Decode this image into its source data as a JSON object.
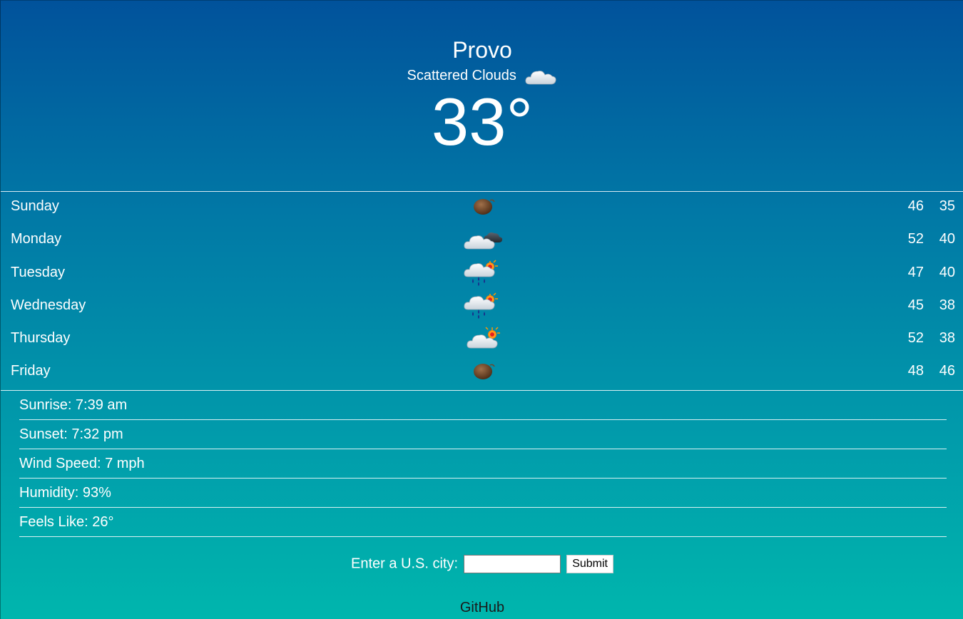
{
  "current": {
    "city": "Provo",
    "condition": "Scattered Clouds",
    "condition_icon": "scattered-clouds-icon",
    "temperature": "33°"
  },
  "forecast": [
    {
      "day": "Sunday",
      "icon": "mist-icon",
      "high": "46",
      "low": "35"
    },
    {
      "day": "Monday",
      "icon": "broken-clouds-icon",
      "high": "52",
      "low": "40"
    },
    {
      "day": "Tuesday",
      "icon": "rain-icon",
      "high": "47",
      "low": "40"
    },
    {
      "day": "Wednesday",
      "icon": "rain-icon",
      "high": "45",
      "low": "38"
    },
    {
      "day": "Thursday",
      "icon": "few-clouds-icon",
      "high": "52",
      "low": "38"
    },
    {
      "day": "Friday",
      "icon": "mist-icon",
      "high": "48",
      "low": "46"
    }
  ],
  "details": {
    "sunrise": "Sunrise: 7:39 am",
    "sunset": "Sunset: 7:32 pm",
    "wind": "Wind Speed: 7 mph",
    "humidity": "Humidity: 93%",
    "feels_like": "Feels Like: 26°"
  },
  "search": {
    "label": "Enter a U.S. city:",
    "value": "",
    "submit_label": "Submit"
  },
  "footer": {
    "github_label": "GitHub"
  },
  "colors": {
    "gradient_top": "#01529b",
    "gradient_bottom": "#00b6ad",
    "text": "#ffffff"
  }
}
